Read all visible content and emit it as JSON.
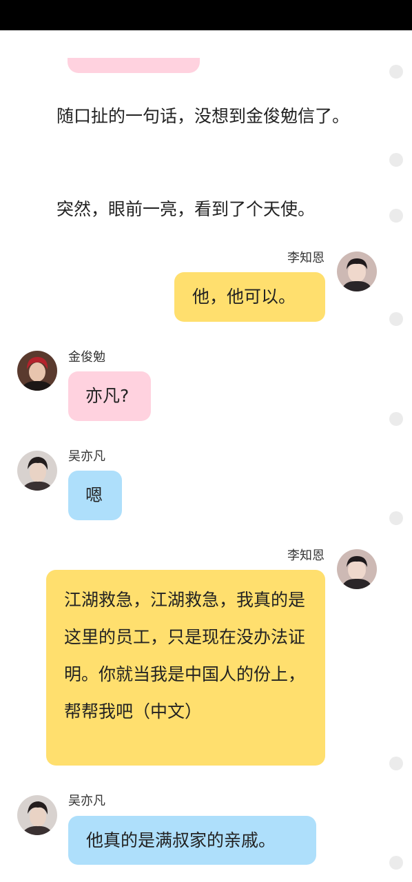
{
  "story": {
    "paragraph_1": "随口扯的一句话，没想到金俊勉信了。",
    "paragraph_2": "突然，眼前一亮，看到了个天使。"
  },
  "messages": [
    {
      "sender": "李知恩",
      "side": "right",
      "color": "#ffdf6e",
      "avatar_icon": "avatar-li-zhien",
      "text": "他，他可以。"
    },
    {
      "sender": "金俊勉",
      "side": "left",
      "color": "#ffd2df",
      "avatar_icon": "avatar-jin-junmian",
      "text": "亦凡?"
    },
    {
      "sender": "吴亦凡",
      "side": "left",
      "color": "#aedffb",
      "avatar_icon": "avatar-wu-yifan",
      "text": "嗯"
    },
    {
      "sender": "李知恩",
      "side": "right",
      "color": "#ffdf6e",
      "avatar_icon": "avatar-li-zhien",
      "text": "江湖救急，江湖救急，我真的是这里的员工，只是现在没办法证明。你就当我是中国人的份上，帮帮我吧（中文）"
    },
    {
      "sender": "吴亦凡",
      "side": "left",
      "color": "#aedffb",
      "avatar_icon": "avatar-wu-yifan",
      "text": "他真的是满叔家的亲戚。"
    }
  ]
}
